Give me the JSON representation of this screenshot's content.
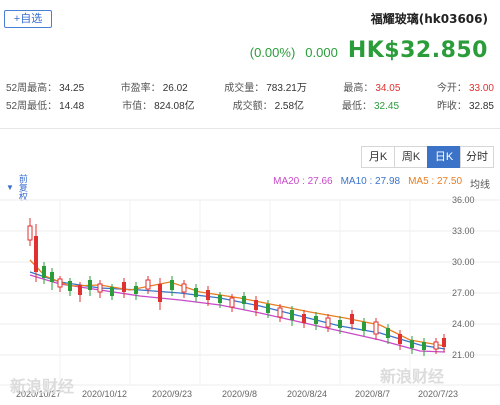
{
  "header": {
    "add_watch_label": "+自选",
    "stock_name": "福耀玻璃(hk03606)"
  },
  "quote": {
    "price": "HK$32.850",
    "change_value": "0.000",
    "change_percent": "(0.00%)",
    "rows": [
      [
        {
          "label": "今开：",
          "value": "33.00",
          "tone": "red"
        },
        {
          "label": "最高：",
          "value": "34.05",
          "tone": "red"
        },
        {
          "label": "成交量：",
          "value": "783.21万",
          "tone": ""
        },
        {
          "label": "市盈率：",
          "value": "26.02",
          "tone": ""
        },
        {
          "label": "52周最高：",
          "value": "34.25",
          "tone": ""
        }
      ],
      [
        {
          "label": "昨收：",
          "value": "32.85",
          "tone": ""
        },
        {
          "label": "最低：",
          "value": "32.45",
          "tone": "green"
        },
        {
          "label": "成交额：",
          "value": "2.58亿",
          "tone": ""
        },
        {
          "label": "市值：",
          "value": "824.08亿",
          "tone": ""
        },
        {
          "label": "52周最低：",
          "value": "14.48",
          "tone": ""
        }
      ]
    ]
  },
  "tabs": [
    {
      "label": "分时",
      "active": false
    },
    {
      "label": "日K",
      "active": true
    },
    {
      "label": "周K",
      "active": false
    },
    {
      "label": "月K",
      "active": false
    }
  ],
  "rights": {
    "label": "前复权"
  },
  "ma_legend": {
    "title": "均线",
    "ma5": "MA5 : 27.50",
    "ma10": "MA10 : 27.98",
    "ma20": "MA20 : 27.66"
  },
  "colors": {
    "up": "#e03131",
    "down": "#2a9d3a",
    "accent": "#3b73c9",
    "ma5": "#e67e22",
    "ma10": "#3b73c9",
    "ma20": "#c94ac9"
  },
  "watermarks": [
    "新浪财经",
    "新浪财经"
  ],
  "chart_data": {
    "type": "candlestick",
    "y_ticks": [
      "36.00",
      "33.00",
      "30.00",
      "27.00",
      "24.00",
      "21.00"
    ],
    "x_ticks": [
      "2020/7/23",
      "2020/8/7",
      "2020/8/24",
      "2020/9/8",
      "2020/9/23",
      "2020/10/12",
      "2020/10/27"
    ],
    "ylim": [
      20,
      36
    ]
  }
}
